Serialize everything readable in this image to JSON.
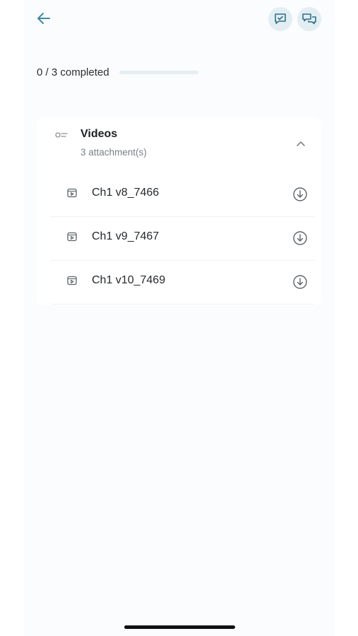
{
  "header": {
    "back_icon": "arrow-left-icon",
    "action_icons": [
      "comment-check-icon",
      "chat-bubbles-icon"
    ],
    "accent_color": "#4a90a4"
  },
  "progress": {
    "label": "0 / 3 completed",
    "completed": 0,
    "total": 3
  },
  "section": {
    "title": "Videos",
    "subtitle": "3 attachment(s)",
    "expanded": true,
    "items": [
      {
        "label": "Ch1 v8_7466"
      },
      {
        "label": "Ch1 v9_7467"
      },
      {
        "label": "Ch1 v10_7469"
      }
    ]
  }
}
